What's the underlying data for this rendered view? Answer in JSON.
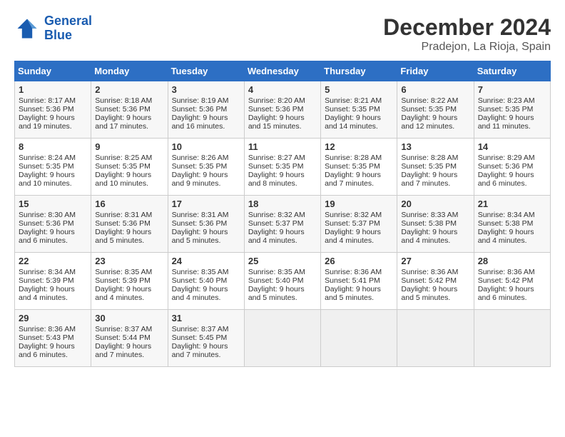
{
  "header": {
    "logo_line1": "General",
    "logo_line2": "Blue",
    "month": "December 2024",
    "location": "Pradejon, La Rioja, Spain"
  },
  "weekdays": [
    "Sunday",
    "Monday",
    "Tuesday",
    "Wednesday",
    "Thursday",
    "Friday",
    "Saturday"
  ],
  "weeks": [
    [
      {
        "day": "1",
        "lines": [
          "Sunrise: 8:17 AM",
          "Sunset: 5:36 PM",
          "Daylight: 9 hours",
          "and 19 minutes."
        ]
      },
      {
        "day": "2",
        "lines": [
          "Sunrise: 8:18 AM",
          "Sunset: 5:36 PM",
          "Daylight: 9 hours",
          "and 17 minutes."
        ]
      },
      {
        "day": "3",
        "lines": [
          "Sunrise: 8:19 AM",
          "Sunset: 5:36 PM",
          "Daylight: 9 hours",
          "and 16 minutes."
        ]
      },
      {
        "day": "4",
        "lines": [
          "Sunrise: 8:20 AM",
          "Sunset: 5:36 PM",
          "Daylight: 9 hours",
          "and 15 minutes."
        ]
      },
      {
        "day": "5",
        "lines": [
          "Sunrise: 8:21 AM",
          "Sunset: 5:35 PM",
          "Daylight: 9 hours",
          "and 14 minutes."
        ]
      },
      {
        "day": "6",
        "lines": [
          "Sunrise: 8:22 AM",
          "Sunset: 5:35 PM",
          "Daylight: 9 hours",
          "and 12 minutes."
        ]
      },
      {
        "day": "7",
        "lines": [
          "Sunrise: 8:23 AM",
          "Sunset: 5:35 PM",
          "Daylight: 9 hours",
          "and 11 minutes."
        ]
      }
    ],
    [
      {
        "day": "8",
        "lines": [
          "Sunrise: 8:24 AM",
          "Sunset: 5:35 PM",
          "Daylight: 9 hours",
          "and 10 minutes."
        ]
      },
      {
        "day": "9",
        "lines": [
          "Sunrise: 8:25 AM",
          "Sunset: 5:35 PM",
          "Daylight: 9 hours",
          "and 10 minutes."
        ]
      },
      {
        "day": "10",
        "lines": [
          "Sunrise: 8:26 AM",
          "Sunset: 5:35 PM",
          "Daylight: 9 hours",
          "and 9 minutes."
        ]
      },
      {
        "day": "11",
        "lines": [
          "Sunrise: 8:27 AM",
          "Sunset: 5:35 PM",
          "Daylight: 9 hours",
          "and 8 minutes."
        ]
      },
      {
        "day": "12",
        "lines": [
          "Sunrise: 8:28 AM",
          "Sunset: 5:35 PM",
          "Daylight: 9 hours",
          "and 7 minutes."
        ]
      },
      {
        "day": "13",
        "lines": [
          "Sunrise: 8:28 AM",
          "Sunset: 5:35 PM",
          "Daylight: 9 hours",
          "and 7 minutes."
        ]
      },
      {
        "day": "14",
        "lines": [
          "Sunrise: 8:29 AM",
          "Sunset: 5:36 PM",
          "Daylight: 9 hours",
          "and 6 minutes."
        ]
      }
    ],
    [
      {
        "day": "15",
        "lines": [
          "Sunrise: 8:30 AM",
          "Sunset: 5:36 PM",
          "Daylight: 9 hours",
          "and 6 minutes."
        ]
      },
      {
        "day": "16",
        "lines": [
          "Sunrise: 8:31 AM",
          "Sunset: 5:36 PM",
          "Daylight: 9 hours",
          "and 5 minutes."
        ]
      },
      {
        "day": "17",
        "lines": [
          "Sunrise: 8:31 AM",
          "Sunset: 5:36 PM",
          "Daylight: 9 hours",
          "and 5 minutes."
        ]
      },
      {
        "day": "18",
        "lines": [
          "Sunrise: 8:32 AM",
          "Sunset: 5:37 PM",
          "Daylight: 9 hours",
          "and 4 minutes."
        ]
      },
      {
        "day": "19",
        "lines": [
          "Sunrise: 8:32 AM",
          "Sunset: 5:37 PM",
          "Daylight: 9 hours",
          "and 4 minutes."
        ]
      },
      {
        "day": "20",
        "lines": [
          "Sunrise: 8:33 AM",
          "Sunset: 5:38 PM",
          "Daylight: 9 hours",
          "and 4 minutes."
        ]
      },
      {
        "day": "21",
        "lines": [
          "Sunrise: 8:34 AM",
          "Sunset: 5:38 PM",
          "Daylight: 9 hours",
          "and 4 minutes."
        ]
      }
    ],
    [
      {
        "day": "22",
        "lines": [
          "Sunrise: 8:34 AM",
          "Sunset: 5:39 PM",
          "Daylight: 9 hours",
          "and 4 minutes."
        ]
      },
      {
        "day": "23",
        "lines": [
          "Sunrise: 8:35 AM",
          "Sunset: 5:39 PM",
          "Daylight: 9 hours",
          "and 4 minutes."
        ]
      },
      {
        "day": "24",
        "lines": [
          "Sunrise: 8:35 AM",
          "Sunset: 5:40 PM",
          "Daylight: 9 hours",
          "and 4 minutes."
        ]
      },
      {
        "day": "25",
        "lines": [
          "Sunrise: 8:35 AM",
          "Sunset: 5:40 PM",
          "Daylight: 9 hours",
          "and 5 minutes."
        ]
      },
      {
        "day": "26",
        "lines": [
          "Sunrise: 8:36 AM",
          "Sunset: 5:41 PM",
          "Daylight: 9 hours",
          "and 5 minutes."
        ]
      },
      {
        "day": "27",
        "lines": [
          "Sunrise: 8:36 AM",
          "Sunset: 5:42 PM",
          "Daylight: 9 hours",
          "and 5 minutes."
        ]
      },
      {
        "day": "28",
        "lines": [
          "Sunrise: 8:36 AM",
          "Sunset: 5:42 PM",
          "Daylight: 9 hours",
          "and 6 minutes."
        ]
      }
    ],
    [
      {
        "day": "29",
        "lines": [
          "Sunrise: 8:36 AM",
          "Sunset: 5:43 PM",
          "Daylight: 9 hours",
          "and 6 minutes."
        ]
      },
      {
        "day": "30",
        "lines": [
          "Sunrise: 8:37 AM",
          "Sunset: 5:44 PM",
          "Daylight: 9 hours",
          "and 7 minutes."
        ]
      },
      {
        "day": "31",
        "lines": [
          "Sunrise: 8:37 AM",
          "Sunset: 5:45 PM",
          "Daylight: 9 hours",
          "and 7 minutes."
        ]
      },
      null,
      null,
      null,
      null
    ]
  ]
}
